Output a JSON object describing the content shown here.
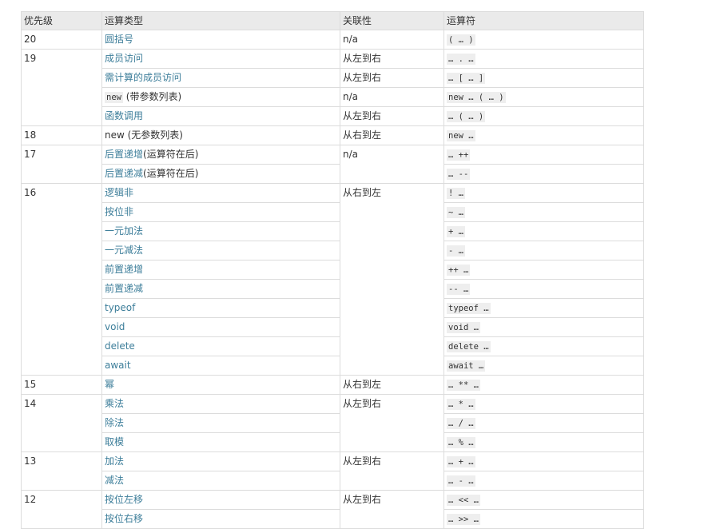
{
  "table": {
    "headers": [
      "优先级",
      "运算类型",
      "关联性",
      "运算符"
    ],
    "groups": [
      {
        "precedence": "20",
        "rows": [
          {
            "type": "圆括号",
            "op": "( … )",
            "assoc": "n/a"
          }
        ]
      },
      {
        "precedence": "19",
        "rows": [
          {
            "type": "成员访问",
            "op": "… . …",
            "assoc": "从左到右"
          },
          {
            "type": "需计算的成员访问",
            "op": "… [ … ]",
            "assoc": "从左到右"
          },
          {
            "type": "new",
            "type_code": true,
            "type_note": " (带参数列表)",
            "op": "new … ( … )",
            "assoc": "n/a"
          },
          {
            "type": "函数调用",
            "op": "… ( … )",
            "assoc": "从左到右"
          }
        ]
      },
      {
        "precedence": "18",
        "rows": [
          {
            "type": "new (无参数列表)",
            "type_link": false,
            "op": "new …",
            "assoc": "从右到左"
          }
        ]
      },
      {
        "precedence": "17",
        "rows": [
          {
            "type": "后置递增",
            "type_note": "(运算符在后)",
            "op": "… ++",
            "assoc": "n/a",
            "assoc_span": 2
          },
          {
            "type": "后置递减",
            "type_note": "(运算符在后)",
            "op": "… --"
          }
        ]
      },
      {
        "precedence": "16",
        "rows": [
          {
            "type": "逻辑非",
            "op": "! …",
            "assoc": "从右到左",
            "assoc_span": 10
          },
          {
            "type": "按位非",
            "op": "~ …"
          },
          {
            "type": "一元加法",
            "op": "+ …"
          },
          {
            "type": "一元减法",
            "op": "- …"
          },
          {
            "type": "前置递增",
            "op": "++ …"
          },
          {
            "type": "前置递减",
            "op": "-- …"
          },
          {
            "type": "typeof",
            "op": "typeof …"
          },
          {
            "type": "void",
            "op": "void …"
          },
          {
            "type": "delete",
            "op": "delete …"
          },
          {
            "type": "await",
            "op": "await …"
          }
        ]
      },
      {
        "precedence": "15",
        "rows": [
          {
            "type": "幂",
            "op": "… ** …",
            "assoc": "从右到左"
          }
        ]
      },
      {
        "precedence": "14",
        "rows": [
          {
            "type": "乘法",
            "op": "… * …",
            "assoc": "从左到右",
            "assoc_span": 3
          },
          {
            "type": "除法",
            "op": "… / …"
          },
          {
            "type": "取模",
            "op": "… % …"
          }
        ]
      },
      {
        "precedence": "13",
        "rows": [
          {
            "type": "加法",
            "op": "… + …",
            "assoc": "从左到右",
            "assoc_span": 2
          },
          {
            "type": "减法",
            "op": "… - …"
          }
        ]
      },
      {
        "precedence": "12",
        "rows": [
          {
            "type": "按位左移",
            "op": "… << …",
            "assoc": "从左到右",
            "assoc_span": 2
          },
          {
            "type": "按位右移",
            "op": "… >> …"
          }
        ]
      }
    ]
  }
}
